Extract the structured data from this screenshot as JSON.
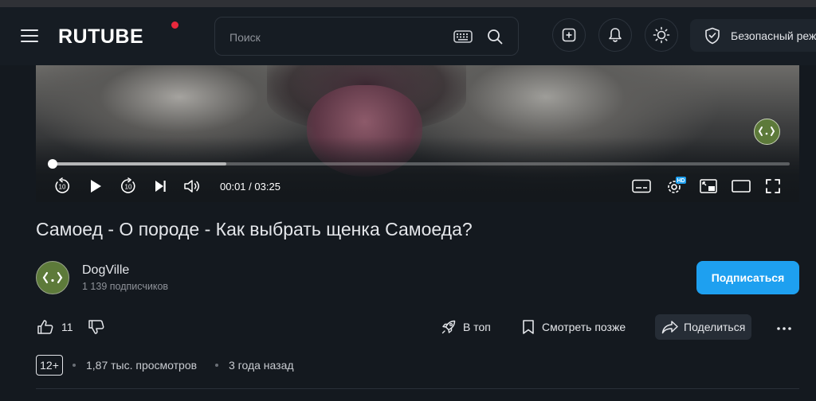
{
  "header": {
    "logo": "RUTUBE",
    "search_placeholder": "Поиск",
    "safe_mode_label": "Безопасный режим"
  },
  "player": {
    "current_time": "00:01",
    "duration": "03:25",
    "time_separator": " / ",
    "progress_fraction": 0.005,
    "buffered_fraction": 0.24,
    "rewind_seconds": "10",
    "forward_seconds": "10",
    "quality_badge": "HD"
  },
  "video": {
    "title": "Самоед - О породе - Как выбрать щенка Самоеда?"
  },
  "channel": {
    "name": "DogVille",
    "subscribers": "1 139 подписчиков",
    "subscribe_label": "Подписаться"
  },
  "actions": {
    "like_count": "11",
    "top_label": "В топ",
    "watch_later_label": "Смотреть позже",
    "share_label": "Поделиться"
  },
  "meta": {
    "age_rating": "12+",
    "views": "1,87 тыс. просмотров",
    "published": "3 года назад"
  },
  "colors": {
    "accent": "#1ea0f0",
    "background": "#14191f",
    "logo_badge": "#e8283c",
    "channel_avatar": "#5d7a3a"
  }
}
